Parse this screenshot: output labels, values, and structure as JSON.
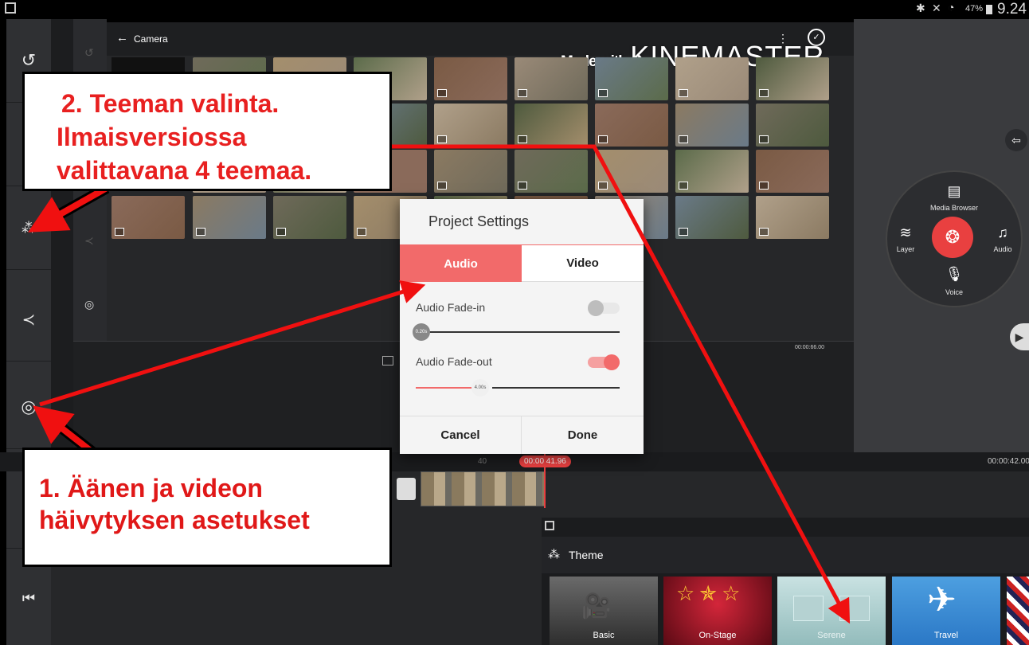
{
  "status_bar": {
    "battery": "47%",
    "time": "9.24"
  },
  "browser": {
    "title": "Camera"
  },
  "watermark": {
    "made_with": "Made with",
    "brand": "KINEMASTER"
  },
  "media_wheel": {
    "media_browser": "Media Browser",
    "layer": "Layer",
    "audio": "Audio",
    "voice": "Voice"
  },
  "dialog": {
    "title": "Project Settings",
    "tabs": [
      "Audio",
      "Video"
    ],
    "fade_in_label": "Audio Fade-in",
    "fade_in_value": "0.20s",
    "fade_out_label": "Audio Fade-out",
    "fade_out_value": "4.00s",
    "cancel": "Cancel",
    "done": "Done"
  },
  "timeline": {
    "time_marker": "40",
    "playhead": "00:00:41.96",
    "end_time": "00:00:42.00",
    "clip_end": "00:00:66.00"
  },
  "theme_panel": {
    "title": "Theme",
    "themes": [
      "Basic",
      "On-Stage",
      "Serene",
      "Travel"
    ]
  },
  "callouts": {
    "settings_line1": "1. Äänen ja videon",
    "settings_line2": "häivytyksen asetukset",
    "theme_line1": "2. Teeman valinta.",
    "theme_line2": "Ilmaisversiossa",
    "theme_line3": "valittavana 4 teemaa."
  },
  "colors": {
    "accent": "#f26a6a",
    "record": "#e94040",
    "callout_text": "#e82020"
  }
}
